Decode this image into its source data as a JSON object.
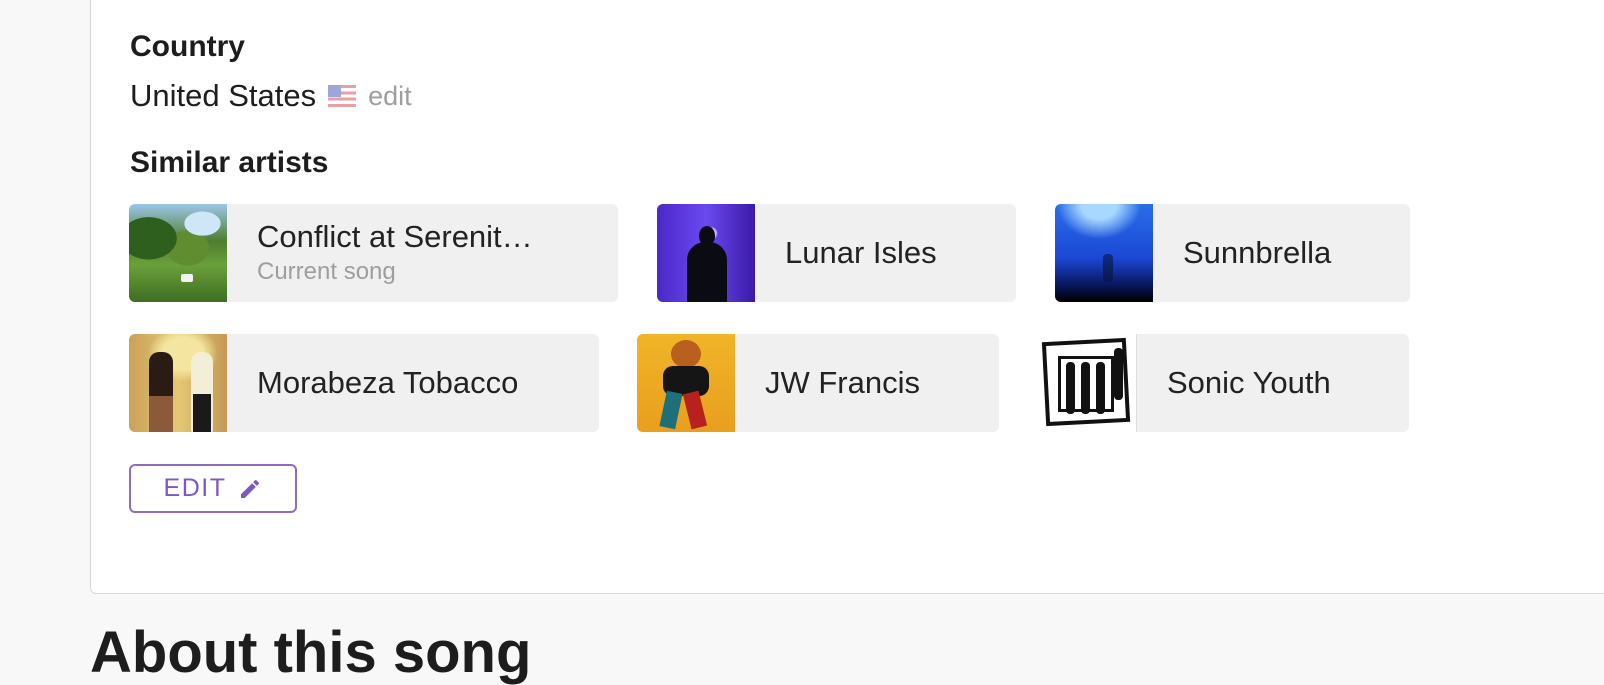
{
  "country": {
    "heading": "Country",
    "name": "United States",
    "flag_icon": "us-flag-icon",
    "edit_label": "edit"
  },
  "similar": {
    "heading": "Similar artists",
    "artists": [
      {
        "name": "Conflict at Serenit…",
        "subtitle": "Current song",
        "image": "garden-photo"
      },
      {
        "name": "Lunar Isles",
        "image": "man-in-purple-lights-photo"
      },
      {
        "name": "Sunnbrella",
        "image": "blue-haze-photo"
      },
      {
        "name": "Morabeza Tobacco",
        "image": "two-people-yellow-wall-photo"
      },
      {
        "name": "JW Francis",
        "image": "man-on-yellow-background-photo"
      },
      {
        "name": "Sonic Youth",
        "image": "black-white-band-photo"
      }
    ]
  },
  "edit_button": {
    "label": "EDIT",
    "icon": "pencil-icon"
  },
  "about": {
    "heading": "About this song"
  },
  "colors": {
    "accent": "#7e57c2",
    "card_bg": "#f0f0f0",
    "muted_text": "#9e9e9e",
    "page_bg": "#f8f8f8"
  }
}
